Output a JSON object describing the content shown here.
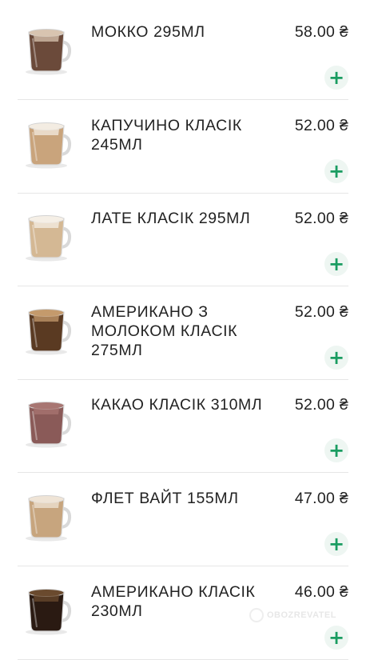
{
  "menu": {
    "items": [
      {
        "name": "МОККО 295МЛ",
        "price": "58.00 ₴",
        "add_label": "+",
        "drink_color": "#6b4a3a",
        "foam_color": "#d8c4b0",
        "icon": "mocha-cup-icon"
      },
      {
        "name": "КАПУЧИНО КЛАСІК 245МЛ",
        "price": "52.00 ₴",
        "add_label": "+",
        "drink_color": "#c9a47c",
        "foam_color": "#f3ece2",
        "icon": "cappuccino-cup-icon"
      },
      {
        "name": "ЛАТЕ КЛАСІК 295МЛ",
        "price": "52.00 ₴",
        "add_label": "+",
        "drink_color": "#d4b894",
        "foam_color": "#f5efe6",
        "icon": "latte-cup-icon"
      },
      {
        "name": "АМЕРИКАНО З МОЛОКОМ КЛАСІК 275МЛ",
        "price": "52.00 ₴",
        "add_label": "+",
        "drink_color": "#5a3a22",
        "foam_color": "#c49a6c",
        "icon": "americano-milk-cup-icon"
      },
      {
        "name": "КАКАО КЛАСІК 310МЛ",
        "price": "52.00 ₴",
        "add_label": "+",
        "drink_color": "#8a5a58",
        "foam_color": "#a87672",
        "icon": "cocoa-cup-icon"
      },
      {
        "name": "ФЛЕТ ВАЙТ 155МЛ",
        "price": "47.00 ₴",
        "add_label": "+",
        "drink_color": "#c7a57e",
        "foam_color": "#efe4d6",
        "icon": "flat-white-cup-icon"
      },
      {
        "name": "АМЕРИКАНО КЛАСІК 230МЛ",
        "price": "46.00 ₴",
        "add_label": "+",
        "drink_color": "#2a1a12",
        "foam_color": "#6a4a2e",
        "icon": "americano-cup-icon"
      }
    ]
  },
  "colors": {
    "add_icon": "#1a9c61",
    "add_bg": "#eef6f2",
    "divider": "#e6e6e6"
  },
  "watermark": {
    "text": "OBOZREVATEL",
    "icon": "obozrevatel-logo-icon"
  }
}
